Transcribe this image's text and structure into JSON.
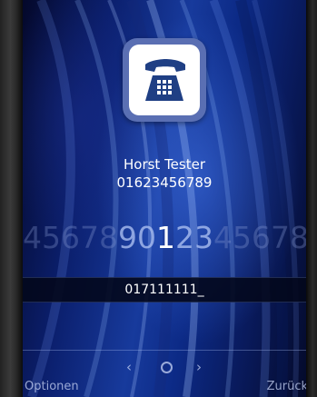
{
  "contact": {
    "name": "Horst Tester",
    "number": "01623456789"
  },
  "app_icon": {
    "name": "telephone-icon",
    "background": "#5a6fb3"
  },
  "digit_picker": {
    "before": [
      "4",
      "5",
      "6",
      "7",
      "8",
      "9",
      "0"
    ],
    "selected": "1",
    "after": [
      "2",
      "3",
      "4",
      "5",
      "6",
      "7",
      "8"
    ]
  },
  "dial_input": {
    "value": "017111111_"
  },
  "navigation": {
    "prev_symbol": "‹",
    "ok_symbol": "o",
    "next_symbol": "›"
  },
  "softkeys": {
    "left_label": "Optionen",
    "right_label": "Zurück"
  },
  "colors": {
    "background": "#0b1f6d",
    "accent": "#173a9c",
    "text": "#ffffff"
  }
}
